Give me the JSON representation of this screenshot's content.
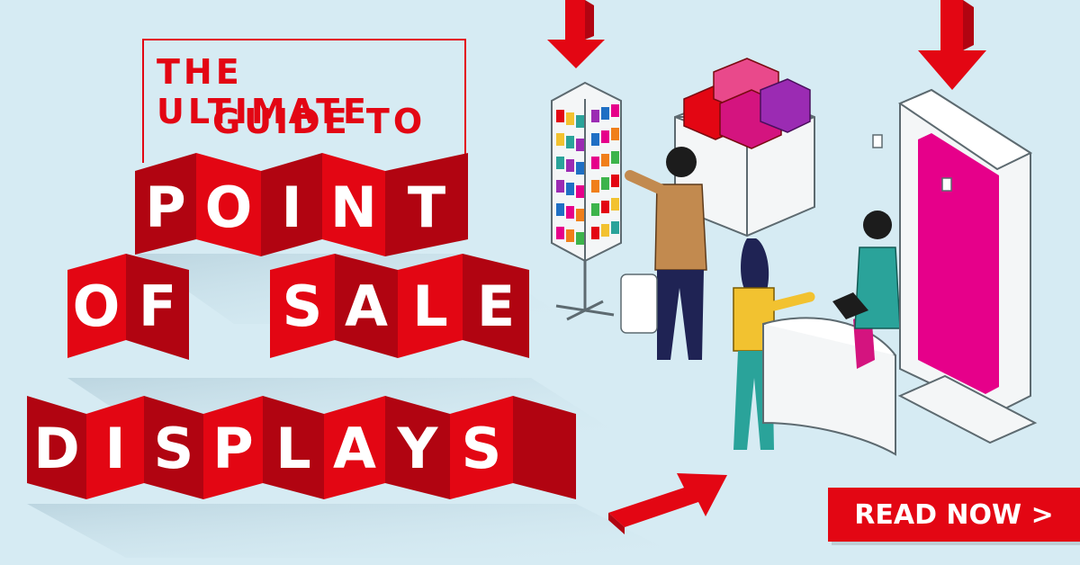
{
  "headline": {
    "line1_pre": "THE",
    "line1_strong": "ULTIMATE",
    "line2": "GUIDE TO",
    "row1": "POINT",
    "row2a": "OF",
    "row2b": "SALE",
    "row3": "DISPLAYS"
  },
  "cta": {
    "label": "READ NOW >"
  },
  "colors": {
    "background": "#d6ebf3",
    "accent": "#e30613",
    "accent_dark": "#b10411",
    "magenta": "#d4147f",
    "purple": "#9b2bb3"
  }
}
